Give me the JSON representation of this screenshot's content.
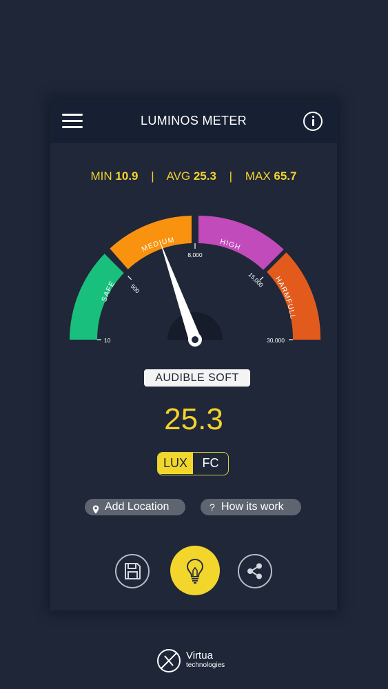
{
  "header": {
    "title": "LUMINOS METER"
  },
  "stats": {
    "min_label": "MIN",
    "min_value": "10.9",
    "avg_label": "AVG",
    "avg_value": "25.3",
    "max_label": "MAX",
    "max_value": "65.7",
    "separator": "|"
  },
  "gauge": {
    "zones": [
      {
        "label": "SAFE",
        "color": "#19c07d"
      },
      {
        "label": "MEDIUM",
        "color": "#f8920f"
      },
      {
        "label": "HIGH",
        "color": "#c24bbb"
      },
      {
        "label": "HARMFULL",
        "color": "#e35b1c"
      }
    ],
    "ticks": [
      "10",
      "500",
      "8,000",
      "15,000",
      "30,000"
    ],
    "needle_position": 0.41
  },
  "mode": "AUDIBLE SOFT",
  "reading": "25.3",
  "units": {
    "options": [
      "LUX",
      "FC"
    ],
    "selected": "LUX"
  },
  "actions": {
    "add_location": "Add Location",
    "how_it_works": "How its work",
    "how_icon": "?"
  },
  "brand": {
    "name": "Virtua",
    "sub": "technologies"
  },
  "colors": {
    "background": "#1e2638",
    "accent": "#f3d22c",
    "header": "#172033"
  },
  "icons": [
    "menu-icon",
    "info-icon",
    "location-pin-icon",
    "question-icon",
    "save-icon",
    "bulb-icon",
    "share-icon",
    "virtua-logo-icon"
  ]
}
